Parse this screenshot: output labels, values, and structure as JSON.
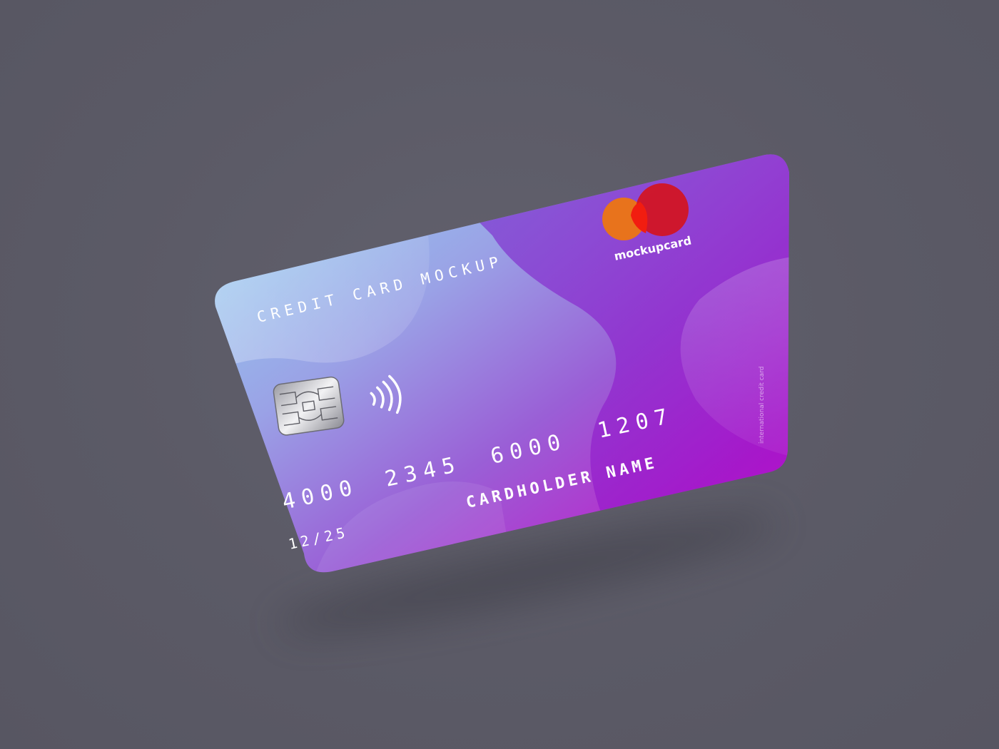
{
  "card": {
    "title": "CREDIT CARD MOCKUP",
    "brand_name": "mockupcard",
    "number_groups": [
      "4000",
      "2345",
      "6000",
      "1207"
    ],
    "cardholder": "CARDHOLDER NAME",
    "expiry": "12/25",
    "side_text": "international credit card",
    "icons": {
      "chip": "emv-chip-icon",
      "contactless": "contactless-icon",
      "logo": "mastercard-logo-icon"
    }
  },
  "colors": {
    "background": "#5b5a66",
    "gradient_start": "#8fd6f0",
    "gradient_mid": "#8a6fd8",
    "gradient_end": "#e01ac8",
    "logo_orange": "#e8731c",
    "logo_red": "#d4141e"
  }
}
